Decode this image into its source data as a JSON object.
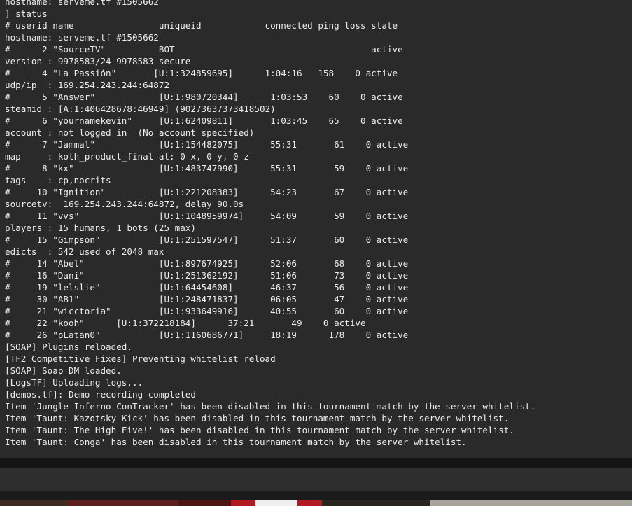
{
  "console": {
    "lines": [
      "hostname: serveme.tf #1505662",
      "] status",
      "# userid name                uniqueid            connected ping loss state",
      "hostname: serveme.tf #1505662",
      "#      2 \"SourceTV\"          BOT                                     active",
      "version : 9978583/24 9978583 secure",
      "#      4 \"La Passión\"       [U:1:324859695]      1:04:16   158    0 active",
      "udp/ip  : 169.254.243.244:64872",
      "#      5 \"Answer\"            [U:1:980720344]      1:03:53    60    0 active",
      "steamid : [A:1:406428678:46949] (90273637373418502)",
      "#      6 \"yournamekevin\"     [U:1:62409811]       1:03:45    65    0 active",
      "account : not logged in  (No account specified)",
      "#      7 \"Jammal\"            [U:1:154482075]      55:31       61    0 active",
      "map     : koth_product_final at: 0 x, 0 y, 0 z",
      "#      8 \"kx\"                [U:1:483747990]      55:31       59    0 active",
      "tags    : cp,nocrits",
      "#     10 \"Ignition\"          [U:1:221208383]      54:23       67    0 active",
      "sourcetv:  169.254.243.244:64872, delay 90.0s",
      "#     11 \"vvs\"               [U:1:1048959974]     54:09       59    0 active",
      "players : 15 humans, 1 bots (25 max)",
      "#     15 \"Gimpson\"           [U:1:251597547]      51:37       60    0 active",
      "edicts  : 542 used of 2048 max",
      "#     14 \"Abel\"              [U:1:897674925]      52:06       68    0 active",
      "#     16 \"Dani\"              [U:1:251362192]      51:06       73    0 active",
      "#     19 \"lelslie\"           [U:1:64454608]       46:37       56    0 active",
      "#     30 \"AB1\"               [U:1:248471837]      06:05       47    0 active",
      "#     21 \"wicctoria\"         [U:1:933649916]      40:55       60    0 active",
      "#     22 \"kooh\"      [U:1:372218184]      37:21       49    0 active",
      "#     26 \"pLatan0\"           [U:1:1160686771]     18:19      178    0 active",
      "[SOAP] Plugins reloaded.",
      "[TF2 Competitive Fixes] Preventing whitelist reload",
      "[SOAP] Soap DM loaded.",
      "[LogsTF] Uploading logs...",
      "[demos.tf]: Demo recording completed",
      "Item 'Jungle Inferno ConTracker' has been disabled in this tournament match by the server whitelist.",
      "Item 'Taunt: Kazotsky Kick' has been disabled in this tournament match by the server whitelist.",
      "Item 'Taunt: The High Five!' has been disabled in this tournament match by the server whitelist.",
      "Item 'Taunt: Conga' has been disabled in this tournament match by the server whitelist."
    ],
    "input_value": ""
  },
  "colors": {
    "background": "#2a2a2a",
    "text": "#ececec",
    "separator": "#141414",
    "input_bg": "#2e2e2e"
  }
}
